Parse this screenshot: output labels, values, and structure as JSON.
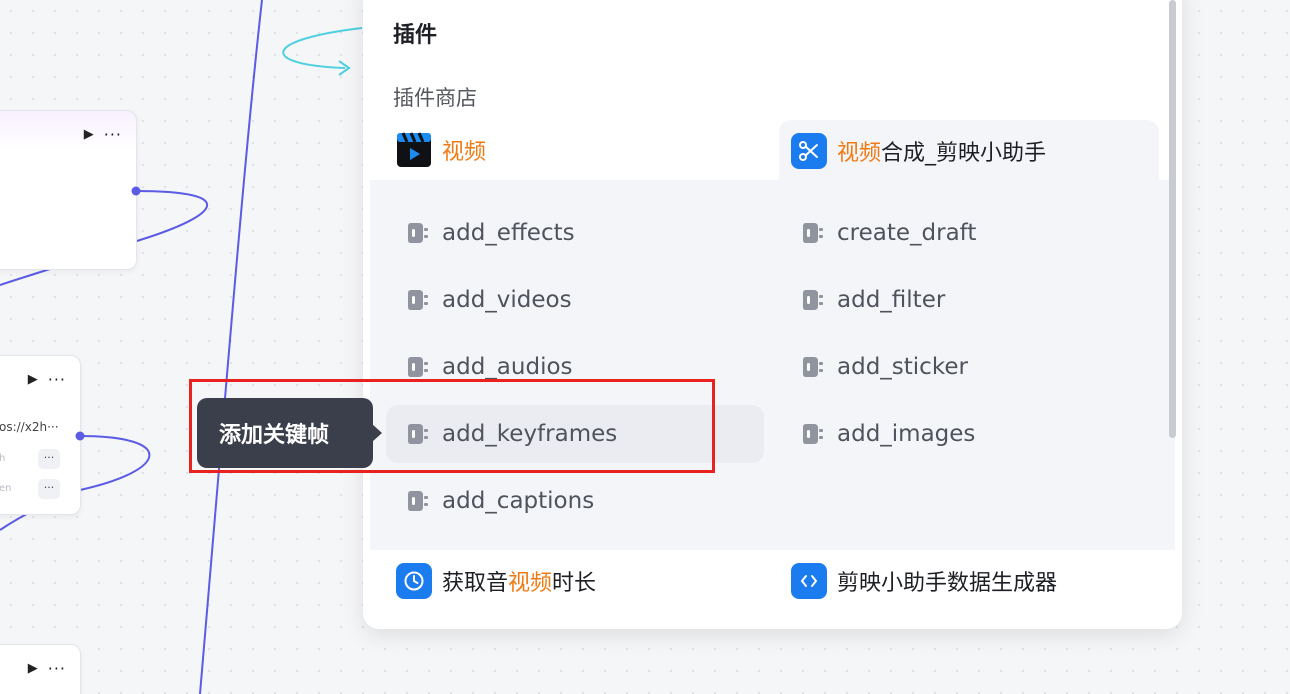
{
  "canvas": {
    "node1": {
      "play": "▶",
      "more": "···"
    },
    "node2": {
      "play": "▶",
      "more": "···",
      "url": "os://x2h···",
      "row1_label": "h",
      "row2_label": "en",
      "pill": "···"
    },
    "node3": {
      "play": "▶",
      "more": "···"
    }
  },
  "panel": {
    "title": "插件",
    "store_label": "插件商店",
    "categories": {
      "video": {
        "label": "视频",
        "highlight": "视频"
      },
      "jianying": {
        "highlight": "视频",
        "rest": "合成_剪映小助手"
      },
      "duration": {
        "pre": "获取音",
        "highlight": "视频",
        "post": "时长"
      },
      "generator": {
        "label": "剪映小助手数据生成器"
      }
    },
    "tools_left": [
      "add_effects",
      "add_videos",
      "add_audios",
      "add_keyframes",
      "add_captions"
    ],
    "tools_right": [
      "create_draft",
      "add_filter",
      "add_sticker",
      "add_images"
    ]
  },
  "tooltip": {
    "text": "添加关键帧"
  },
  "colors": {
    "accent_orange": "#f07a12",
    "brand_blue": "#1b7cf0",
    "annotation_red": "#e8231f",
    "edge_blue": "#5b5be6",
    "edge_cyan": "#4fd0e0"
  }
}
